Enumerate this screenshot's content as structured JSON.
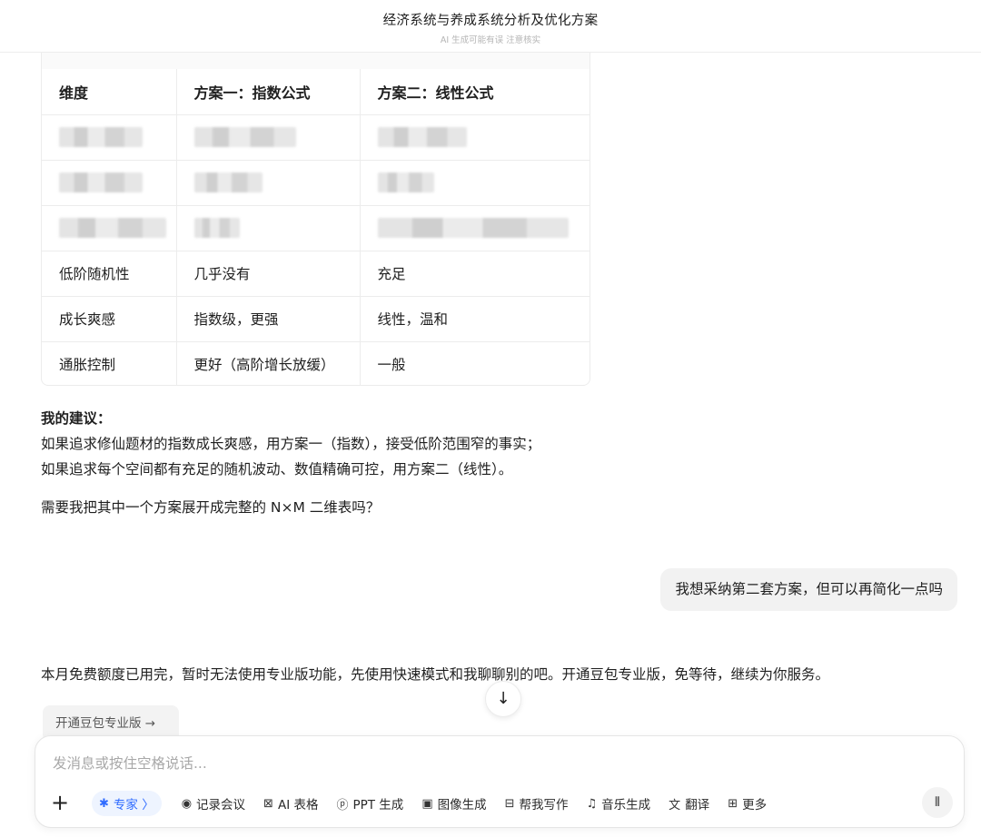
{
  "header": {
    "title": "经济系统与养成系统分析及优化方案",
    "subtitle": "AI 生成可能有误 注意核实"
  },
  "table": {
    "headers": [
      "维度",
      "方案一：指数公式",
      "方案二：线性公式"
    ],
    "rows": [
      [
        "低阶随机性",
        "几乎没有",
        "充足"
      ],
      [
        "成长爽感",
        "指数级，更强",
        "线性，温和"
      ],
      [
        "通胀控制",
        "更好（高阶增长放缓）",
        "一般"
      ]
    ]
  },
  "advice": {
    "heading": "我的建议：",
    "line1": "如果追求修仙题材的指数成长爽感，用方案一（指数），接受低阶范围窄的事实；",
    "line2": "如果追求每个空间都有充足的随机波动、数值精确可控，用方案二（线性）。"
  },
  "question": "需要我把其中一个方案展开成完整的 N×M 二维表吗？",
  "user_message": "我想采纳第二套方案，但可以再简化一点吗",
  "quota_notice": "本月免费额度已用完，暂时无法使用专业版功能，先使用快速模式和我聊聊别的吧。开通豆包专业版，免等待，继续为你服务。",
  "upgrade_button": "开通豆包专业版 →",
  "scroll_icon": "arrow-down-icon",
  "composer": {
    "placeholder": "发消息或按住空格说话...",
    "tools": [
      {
        "label": "专家 〉",
        "icon": "expert-icon"
      },
      {
        "label": "记录会议",
        "icon": "record-icon"
      },
      {
        "label": "AI 表格",
        "icon": "table-icon"
      },
      {
        "label": "PPT 生成",
        "icon": "ppt-icon"
      },
      {
        "label": "图像生成",
        "icon": "image-icon"
      },
      {
        "label": "帮我写作",
        "icon": "write-icon"
      },
      {
        "label": "音乐生成",
        "icon": "music-icon"
      },
      {
        "label": "翻译",
        "icon": "translate-icon"
      },
      {
        "label": "更多",
        "icon": "more-icon"
      }
    ]
  },
  "colors": {
    "accent": "#2f6bff",
    "bubble": "#f2f2f2"
  }
}
